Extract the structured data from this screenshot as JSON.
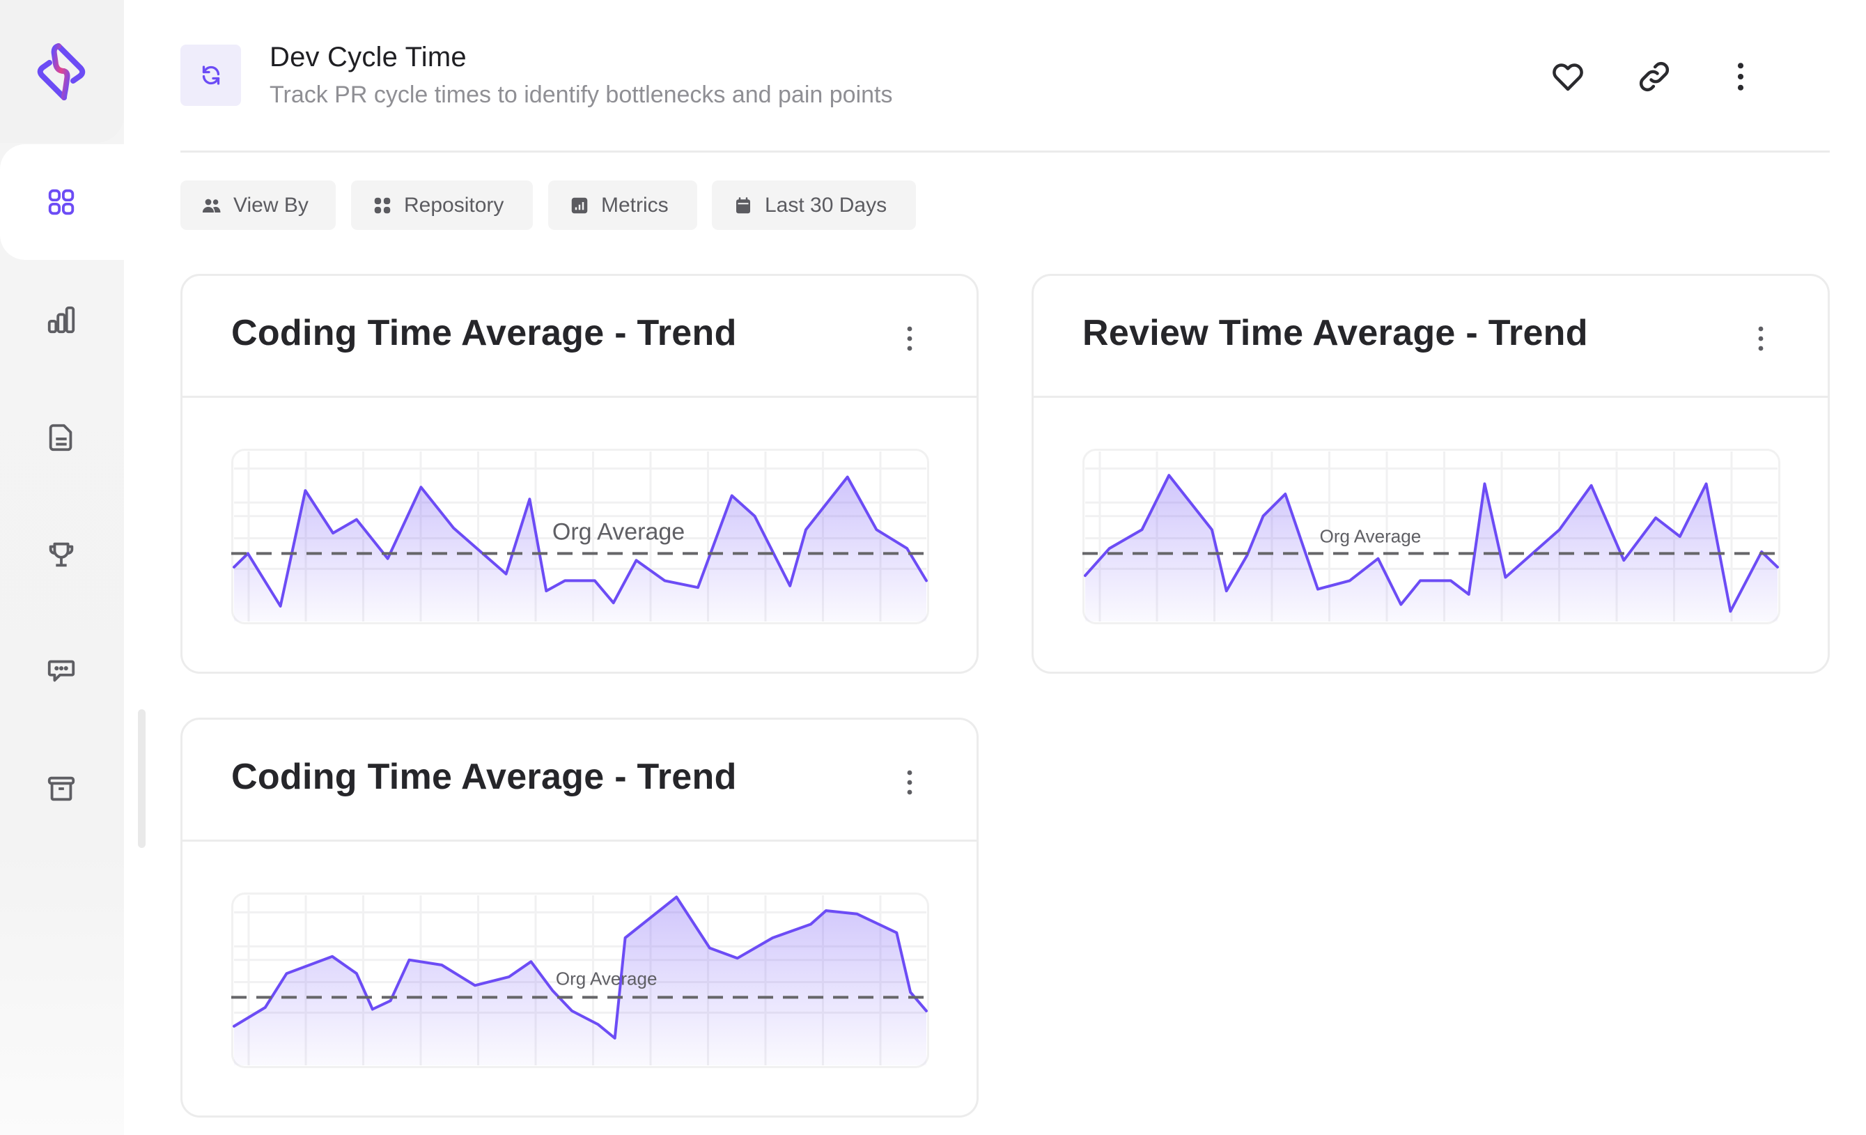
{
  "app": {
    "accent_color": "#6c4cf5",
    "logo_icon": "brand-logo-icon"
  },
  "sidebar": {
    "items": [
      {
        "id": "dashboard",
        "icon": "grid-icon",
        "active": true
      },
      {
        "id": "analytics",
        "icon": "bar-chart-icon",
        "active": false
      },
      {
        "id": "reports",
        "icon": "document-icon",
        "active": false
      },
      {
        "id": "achievements",
        "icon": "trophy-icon",
        "active": false
      },
      {
        "id": "feedback",
        "icon": "chat-bubble-icon",
        "active": false
      },
      {
        "id": "archive",
        "icon": "archive-box-icon",
        "active": false
      }
    ]
  },
  "header": {
    "icon": "refresh-cycle-icon",
    "title": "Dev Cycle Time",
    "subtitle": "Track PR cycle times to identify bottlenecks and pain points",
    "actions": [
      {
        "id": "favorite",
        "icon": "heart-icon"
      },
      {
        "id": "copy-link",
        "icon": "link-icon"
      },
      {
        "id": "more",
        "icon": "kebab-vertical-icon"
      }
    ]
  },
  "filters": [
    {
      "label": "View By",
      "icon": "people-icon"
    },
    {
      "label": "Repository",
      "icon": "grid-dots-icon"
    },
    {
      "label": "Metrics",
      "icon": "bar-chart-square-icon"
    },
    {
      "label": "Last 30 Days",
      "icon": "calendar-icon"
    }
  ],
  "cards": [
    {
      "title": "Coding Time Average - Trend",
      "menu_icon": "kebab-vertical-icon"
    },
    {
      "title": "Review Time Average - Trend",
      "menu_icon": "kebab-vertical-icon"
    },
    {
      "title": "Coding Time Average - Trend",
      "menu_icon": "kebab-vertical-icon"
    }
  ],
  "chart_data": [
    {
      "type": "area",
      "title": "Coding Time Average - Trend",
      "xlabel": "",
      "ylabel": "",
      "note": "No axis tick labels shown; values are relative (0 = plot bottom, 100 = plot top), x is fraction of period",
      "ylim": [
        0,
        100
      ],
      "reference_line": {
        "label": "Org Average",
        "value": 40,
        "style": "dashed"
      },
      "x": [
        0,
        0.02,
        0.067,
        0.103,
        0.143,
        0.177,
        0.222,
        0.27,
        0.317,
        0.393,
        0.427,
        0.451,
        0.478,
        0.521,
        0.548,
        0.581,
        0.622,
        0.67,
        0.719,
        0.752,
        0.803,
        0.826,
        0.886,
        0.928,
        0.972,
        1.0
      ],
      "values": [
        32,
        40,
        9,
        77,
        52,
        60,
        37,
        79,
        55,
        28,
        72,
        18,
        24,
        24,
        11,
        36,
        24,
        20,
        74,
        62,
        21,
        54,
        85,
        54,
        43,
        24
      ],
      "grid": true
    },
    {
      "type": "area",
      "title": "Review Time Average - Trend",
      "xlabel": "",
      "ylabel": "",
      "note": "No axis tick labels shown; values are relative (0 = plot bottom, 100 = plot top), x is fraction of period",
      "ylim": [
        0,
        100
      ],
      "reference_line": {
        "label": "Org Average",
        "value": 40,
        "style": "dashed"
      },
      "x": [
        0,
        0.035,
        0.082,
        0.121,
        0.183,
        0.204,
        0.234,
        0.257,
        0.289,
        0.336,
        0.382,
        0.423,
        0.456,
        0.484,
        0.528,
        0.554,
        0.577,
        0.607,
        0.685,
        0.731,
        0.778,
        0.824,
        0.859,
        0.897,
        0.932,
        0.977,
        1.0
      ],
      "values": [
        27,
        43,
        54,
        86,
        54,
        18,
        39,
        62,
        75,
        19,
        24,
        37,
        10,
        24,
        24,
        16,
        81,
        26,
        54,
        80,
        36,
        61,
        50,
        81,
        6,
        41,
        32
      ],
      "grid": true
    },
    {
      "type": "area",
      "title": "Coding Time Average - Trend",
      "xlabel": "",
      "ylabel": "",
      "note": "No axis tick labels shown; values are relative (0 = plot bottom, 100 = plot top), x is fraction of period",
      "ylim": [
        0,
        100
      ],
      "reference_line": {
        "label": "Org Average",
        "value": 40,
        "style": "dashed"
      },
      "x": [
        0,
        0.045,
        0.076,
        0.142,
        0.177,
        0.2,
        0.226,
        0.253,
        0.3,
        0.348,
        0.397,
        0.429,
        0.46,
        0.488,
        0.526,
        0.55,
        0.565,
        0.639,
        0.687,
        0.727,
        0.778,
        0.833,
        0.855,
        0.9,
        0.957,
        0.977,
        1.0
      ],
      "values": [
        23,
        34,
        54,
        64,
        54,
        33,
        38,
        62,
        59,
        47,
        52,
        61,
        44,
        32,
        24,
        16,
        75,
        99,
        69,
        63,
        75,
        83,
        91,
        89,
        78,
        43,
        32
      ],
      "grid": true
    }
  ]
}
